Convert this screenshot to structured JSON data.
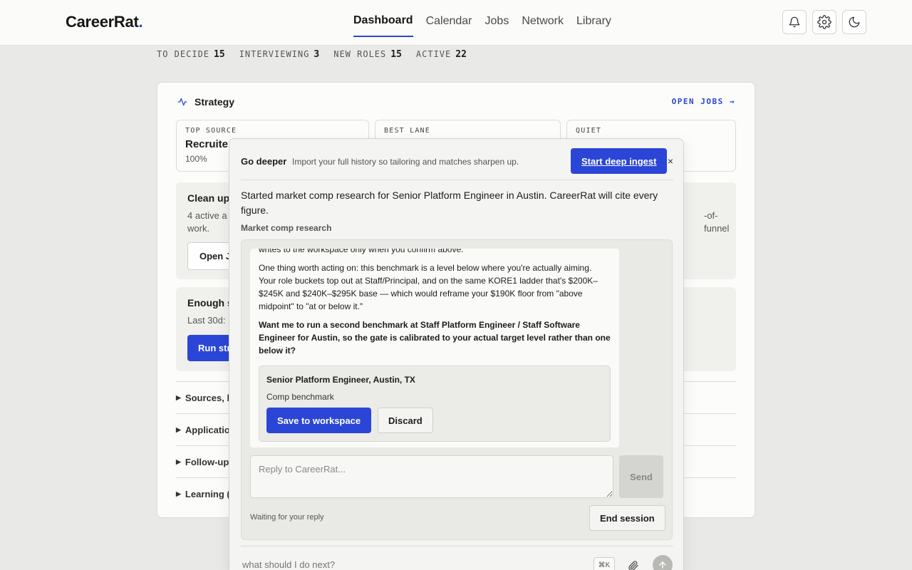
{
  "header": {
    "logo_text": "CareerRat",
    "logo_dot": ".",
    "nav": [
      "Dashboard",
      "Calendar",
      "Jobs",
      "Network",
      "Library"
    ],
    "active_nav": "Dashboard",
    "icons": [
      "bell-icon",
      "gear-icon",
      "moon-icon"
    ]
  },
  "stats": [
    {
      "label": "TO DECIDE",
      "value": "15"
    },
    {
      "label": "INTERVIEWING",
      "value": "3"
    },
    {
      "label": "NEW ROLES",
      "value": "15"
    },
    {
      "label": "ACTIVE",
      "value": "22"
    }
  ],
  "strategy": {
    "title": "Strategy",
    "open_jobs": "OPEN JOBS",
    "tiles": [
      {
        "label": "TOP SOURCE",
        "value": "Recruite",
        "sub": "100%"
      },
      {
        "label": "BEST LANE",
        "value": "",
        "sub": ""
      },
      {
        "label": "QUIET",
        "value": "",
        "sub": ""
      }
    ],
    "cleanup": {
      "title": "Clean up",
      "body_left": "4 active a",
      "body_right": "-of-funnel",
      "body_line2": "work.",
      "button": "Open J"
    },
    "enough": {
      "title": "Enough s",
      "body": "Last 30d:",
      "button": "Run str"
    },
    "collapsibles": [
      "Sources, la",
      "Applicatio",
      "Follow-up",
      "Learning (l"
    ]
  },
  "overlay": {
    "deeper_title": "Go deeper",
    "deeper_text": "Import your full history so tailoring and matches sharpen up.",
    "ingest_button": "Start deep ingest",
    "close": "×",
    "started": "Started market comp research for Senior Platform Engineer in Austin. CareerRat will cite every figure.",
    "comp_label": "Market comp research",
    "msg_partial": "writes to the workspace only when you confirm above.",
    "msg_p1": "One thing worth acting on: this benchmark is a level below where you're actually aiming. Your role buckets top out at Staff/Principal, and on the same KORE1 ladder that's $200K–$245K and $240K–$295K base — which would reframe your $190K floor from \"above midpoint\" to \"at or below it.\"",
    "msg_p2": "Want me to run a second benchmark at Staff Platform Engineer / Staff Software Engineer for Austin, so the gate is calibrated to your actual target level rather than one below it?",
    "bench_title": "Senior Platform Engineer, Austin, TX",
    "bench_sub": "Comp benchmark",
    "save_button": "Save to workspace",
    "discard_button": "Discard",
    "reply_placeholder": "Reply to CareerRat...",
    "send_button": "Send",
    "waiting": "Waiting for your reply",
    "end_button": "End session",
    "composer_placeholder": "what should I do next?",
    "kbd": "⌘K"
  }
}
